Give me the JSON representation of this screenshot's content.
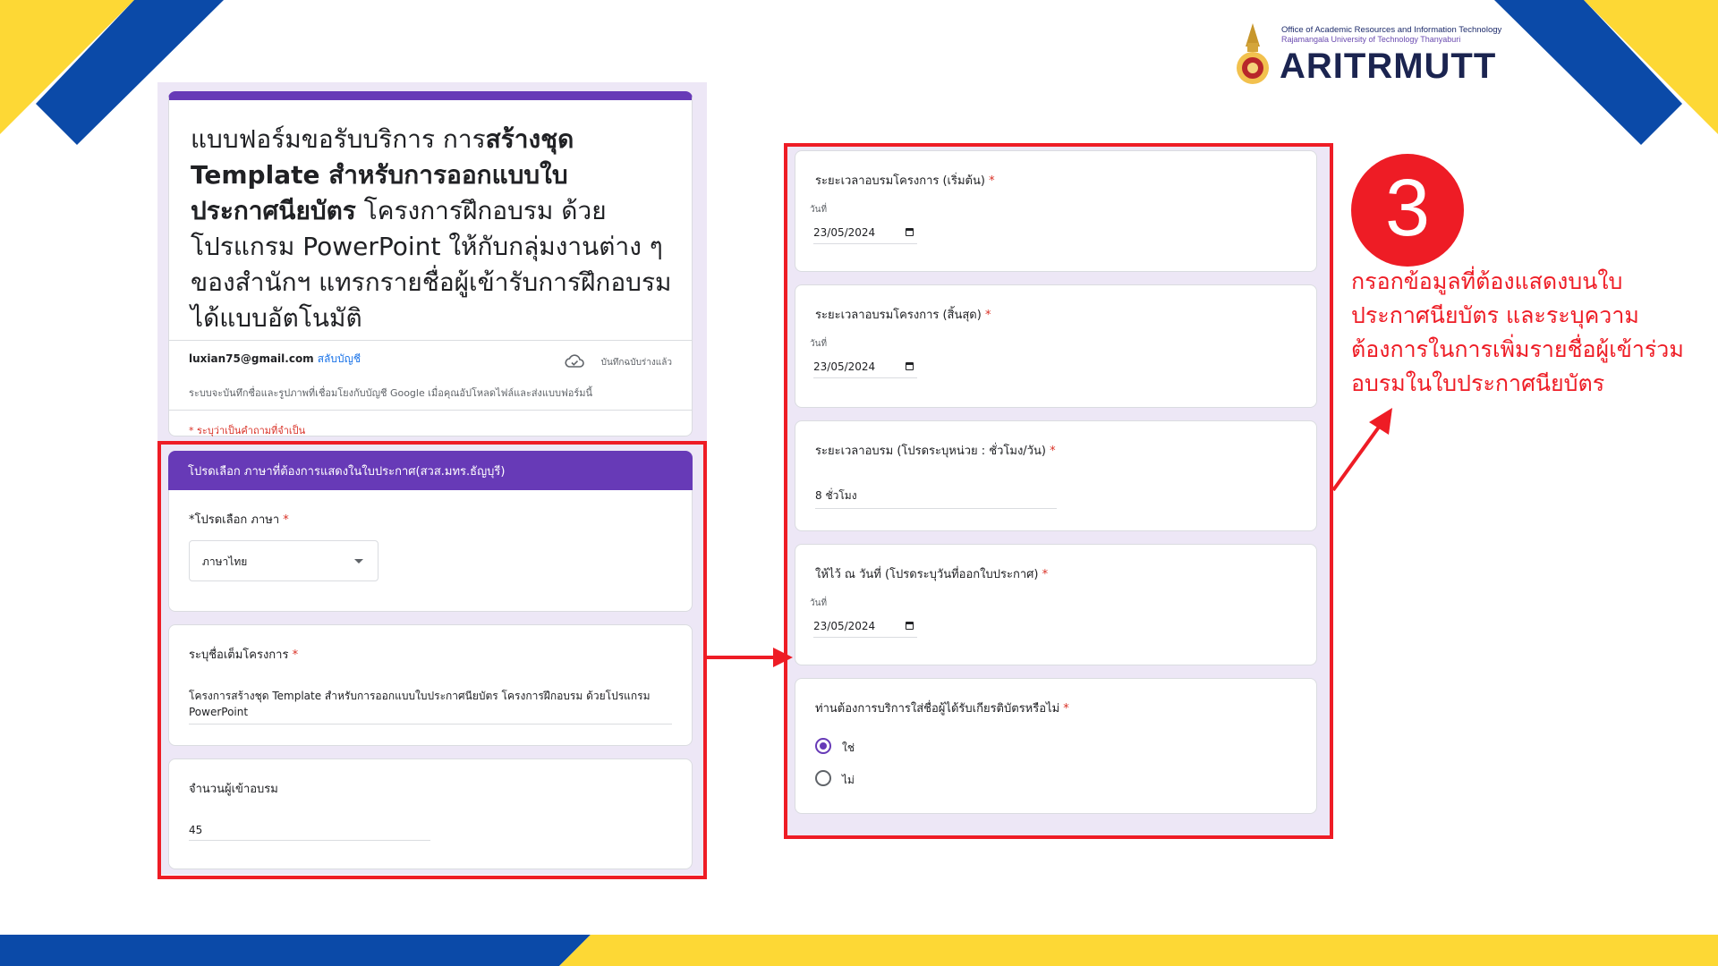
{
  "logo": {
    "line1": "Office of Academic Resources and Information Technology",
    "line2": "Rajamangala University of Technology Thanyaburi",
    "wordmark": "ARITRMUTT"
  },
  "header_card": {
    "title_plain_1": "แบบฟอร์มขอรับบริการ การ",
    "title_bold_1": "สร้างชุด Template สำหรับการออกแบบใบประกาศนียบัตร",
    "title_plain_2": " โครงการฝึกอบรม ด้วยโปรแกรม PowerPoint ให้กับกลุ่มงานต่าง ๆ ของสำนักฯ แทรกรายชื่อผู้เข้ารับการฝึกอบรมได้แบบอัตโนมัติ",
    "account_email": "luxian75@gmail.com",
    "switch_account": "สลับบัญชี",
    "saved_status": "บันทึกฉบับร่างแล้ว",
    "save_note": "ระบบจะบันทึกชื่อและรูปภาพที่เชื่อมโยงกับบัญชี Google เมื่อคุณอัปโหลดไฟล์และส่งแบบฟอร์มนี้",
    "required_note": "* ระบุว่าเป็นคำถามที่จำเป็น"
  },
  "section_left": {
    "header": "โปรดเลือก ภาษาที่ต้องการแสดงในใบประกาศ(สวส.มทร.ธัญบุรี)",
    "language_q": "*โปรดเลือก ภาษา",
    "language_value": "ภาษาไทย",
    "project_q": "ระบุชื่อเต็มโครงการ ",
    "project_value": "โครงการสร้างชุด Template สำหรับการออกแบบใบประกาศนียบัตร โครงการฝึกอบรม ด้วยโปรแกรม PowerPoint",
    "participants_q": "จำนวนผู้เข้าอบรม",
    "participants_value": "45"
  },
  "section_right": {
    "start_q": "ระยะเวลาอบรมโครงการ (เริ่มต้น)",
    "start_label": "วันที่",
    "start_value": "23/05/2024",
    "end_q": "ระยะเวลาอบรมโครงการ (สิ้นสุด)",
    "end_label": "วันที่",
    "end_value": "23/05/2024",
    "duration_q": "ระยะเวลาอบรม (โปรดระบุหน่วย : ชั่วโมง/วัน)",
    "duration_value": "8 ชั่วโมง",
    "issue_q": "ให้ไว้ ณ วันที่ (โปรดระบุวันที่ออกใบประกาศ)",
    "issue_label": "วันที่",
    "issue_value": "23/05/2024",
    "names_q": "ท่านต้องการบริการใส่ชื่อผู้ได้รับเกียรติบัตรหรือไม่",
    "option_yes": "ใช่",
    "option_no": "ไม่",
    "selected": "ใช่"
  },
  "step": {
    "number": "3",
    "text": "กรอกข้อมูลที่ต้องแสดงบนใบประกาศนียบัตร และระบุความต้องการในการเพิ่มรายชื่อผู้เข้าร่วมอบรมในใบประกาศนียบัตร"
  },
  "colors": {
    "accent_red": "#ee1c25",
    "form_purple": "#673ab7",
    "deco_blue": "#0b4aa8",
    "deco_yellow": "#fdd835"
  }
}
